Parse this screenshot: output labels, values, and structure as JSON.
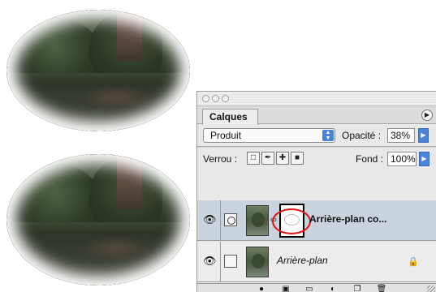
{
  "palette": {
    "tab_label": "Calques",
    "menu_icon": "triangle-right-icon",
    "blend_mode": "Produit",
    "opacity_label": "Opacité :",
    "opacity_value": "38%",
    "lock_label": "Verrou :",
    "fill_label": "Fond :",
    "fill_value": "100%",
    "lock_icons": [
      "lock-transparency-icon",
      "lock-paint-icon",
      "lock-move-icon",
      "lock-all-icon"
    ],
    "layers": [
      {
        "name": "Arrière-plan co...",
        "visible": true,
        "has_mask": true,
        "selected": true
      },
      {
        "name": "Arrière-plan",
        "visible": true,
        "locked": true,
        "selected": false
      }
    ],
    "bottom_icons": [
      "layer-style-icon",
      "add-mask-icon",
      "new-group-icon",
      "adjustment-layer-icon",
      "new-layer-icon",
      "trash-icon"
    ],
    "highlight_color": "#e01515",
    "accent_color": "#4b83d9"
  }
}
